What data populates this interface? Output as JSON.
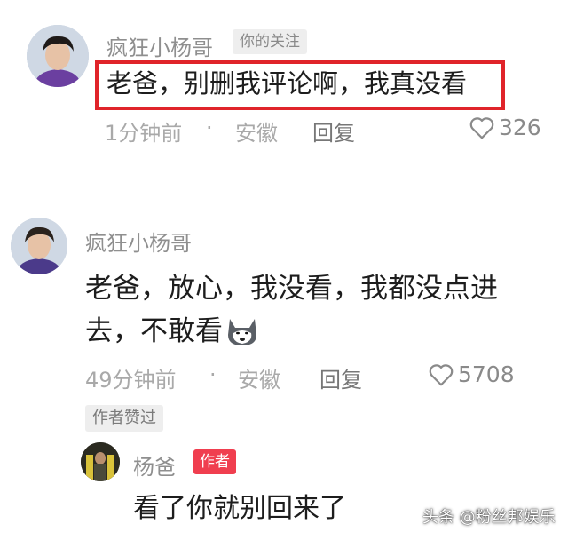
{
  "comments": [
    {
      "username": "疯狂小杨哥",
      "follow_tag": "你的关注",
      "text": "老爸，别删我评论啊，我真没看",
      "time": "1分钟前",
      "location": "安徽",
      "reply_label": "回复",
      "likes": "326"
    },
    {
      "username": "疯狂小杨哥",
      "text_line1": "老爸，放心，我没看，我都没点进",
      "text_line2": "去，不敢看",
      "emoji": "husky-dog-emoji",
      "time": "49分钟前",
      "location": "安徽",
      "reply_label": "回复",
      "likes": "5708",
      "liked_tag": "作者赞过"
    }
  ],
  "reply": {
    "username": "杨爸",
    "author_tag": "作者",
    "text": "看了你就别回来了"
  },
  "separator": "·",
  "watermark": "头条 @粉丝邦娱乐",
  "colors": {
    "highlight": "#e0242a",
    "author_tag": "#f03e4f",
    "muted": "#a9a9a9"
  }
}
